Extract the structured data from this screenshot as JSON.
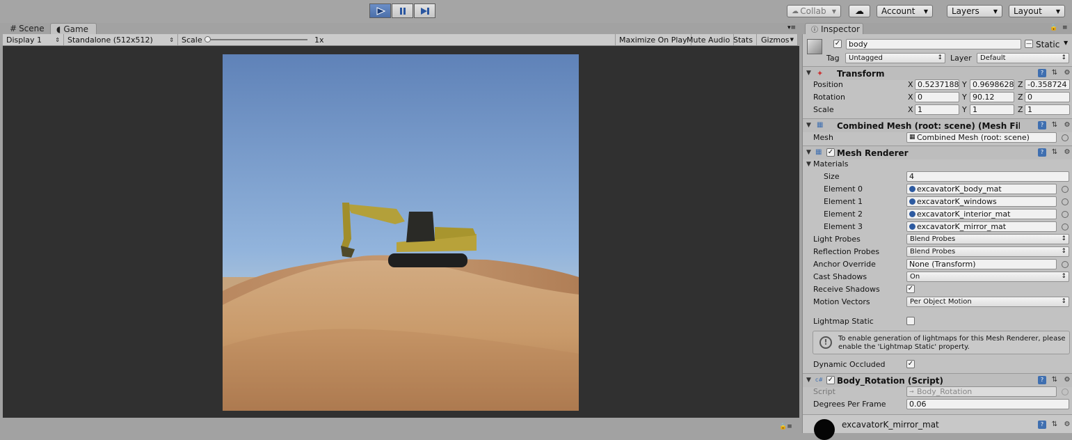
{
  "toolbar": {
    "play_label": "Play",
    "pause_label": "Pause",
    "step_label": "Step",
    "collab": "Collab",
    "account": "Account",
    "layers": "Layers",
    "layout": "Layout"
  },
  "tabs": {
    "scene": "Scene",
    "game": "Game",
    "inspector": "Inspector"
  },
  "gamebar": {
    "display": "Display 1",
    "resolution": "Standalone (512x512)",
    "scale_label": "Scale",
    "scale_value": "1x",
    "maximize": "Maximize On Play",
    "mute": "Mute Audio",
    "stats": "Stats",
    "gizmos": "Gizmos"
  },
  "inspector": {
    "object_name": "body",
    "static_label": "Static",
    "tag_label": "Tag",
    "tag_value": "Untagged",
    "layer_label": "Layer",
    "layer_value": "Default",
    "transform": {
      "title": "Transform",
      "position_label": "Position",
      "rotation_label": "Rotation",
      "scale_label": "Scale",
      "x": "X",
      "y": "Y",
      "z": "Z",
      "position": [
        "0.5237188",
        "0.9698628",
        "-0.358724"
      ],
      "rotation": [
        "0",
        "90.12",
        "0"
      ],
      "scale": [
        "1",
        "1",
        "1"
      ]
    },
    "mesh_filter": {
      "title": "Combined Mesh (root: scene) (Mesh Filte",
      "mesh_label": "Mesh",
      "mesh_value": "Combined Mesh (root: scene)"
    },
    "mesh_renderer": {
      "title": "Mesh Renderer",
      "materials_label": "Materials",
      "size_label": "Size",
      "size_value": "4",
      "elements": [
        {
          "label": "Element 0",
          "value": "excavatorK_body_mat"
        },
        {
          "label": "Element 1",
          "value": "excavatorK_windows"
        },
        {
          "label": "Element 2",
          "value": "excavatorK_interior_mat"
        },
        {
          "label": "Element 3",
          "value": "excavatorK_mirror_mat"
        }
      ],
      "light_probes_label": "Light Probes",
      "light_probes_value": "Blend Probes",
      "reflection_probes_label": "Reflection Probes",
      "reflection_probes_value": "Blend Probes",
      "anchor_label": "Anchor Override",
      "anchor_value": "None (Transform)",
      "cast_shadows_label": "Cast Shadows",
      "cast_shadows_value": "On",
      "receive_shadows_label": "Receive Shadows",
      "motion_vectors_label": "Motion Vectors",
      "motion_vectors_value": "Per Object Motion",
      "lightmap_static_label": "Lightmap Static",
      "info_text_1": "To enable generation of lightmaps for this Mesh Renderer, please",
      "info_text_2": "enable the 'Lightmap Static' property.",
      "dynamic_occluded_label": "Dynamic Occluded"
    },
    "script_component": {
      "title": "Body_Rotation (Script)",
      "script_label": "Script",
      "script_value": "Body_Rotation",
      "degrees_label": "Degrees Per Frame",
      "degrees_value": "0.06"
    },
    "material_preview": "excavatorK_mirror_mat"
  },
  "colors": {
    "play_active": "#4b6fa9",
    "sky_top": "#5f82b8",
    "sand": "#c99a6a"
  }
}
